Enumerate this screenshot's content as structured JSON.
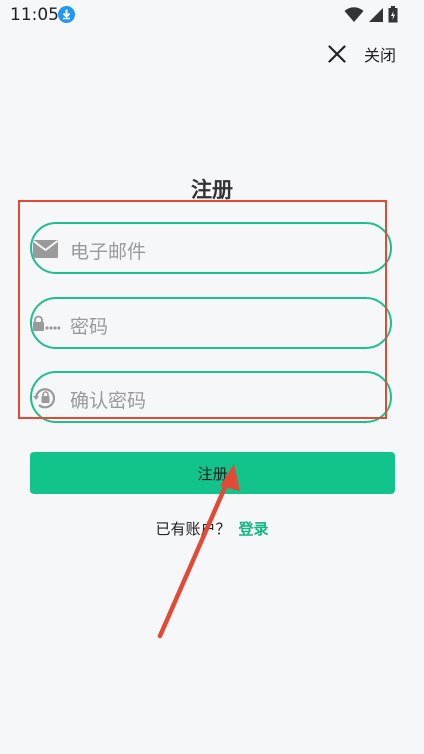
{
  "status_bar": {
    "time": "11:05",
    "icons": [
      "download-icon",
      "wifi-icon",
      "signal-icon",
      "battery-icon"
    ]
  },
  "header": {
    "close_label": "关闭",
    "close_icon": "close-icon"
  },
  "form": {
    "title": "注册",
    "email_placeholder": "电子邮件",
    "password_placeholder": "密码",
    "confirm_placeholder": "确认密码",
    "submit_label": "注册"
  },
  "footer": {
    "have_account_text": "已有账户？",
    "login_link": "登录"
  },
  "colors": {
    "accent": "#12c48b",
    "field_border": "#1fbf8f",
    "annotation": "#e24a36",
    "background": "#f6f7f9"
  }
}
